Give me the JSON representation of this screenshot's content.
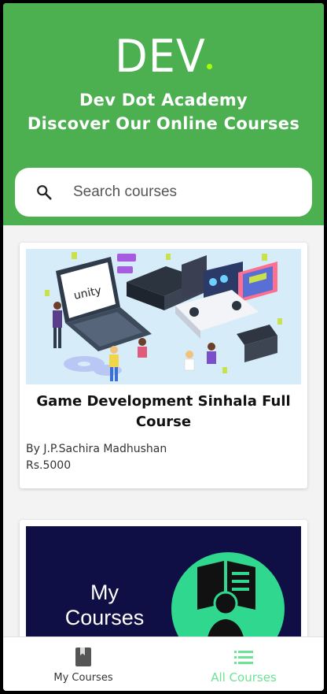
{
  "header": {
    "logo": "DEV",
    "academy_name": "Dev Dot Academy",
    "tagline": "Discover Our Online Courses",
    "background_color": "#4caf50",
    "logo_dot_color": "#a6ff00"
  },
  "search": {
    "placeholder": "Search courses",
    "icon": "search-icon"
  },
  "courses": [
    {
      "image_text": "unity",
      "title": "Game Development Sinhala Full Course",
      "author": "By J.P.Sachira Madhushan",
      "price": "Rs.5000"
    },
    {
      "image_text": "My Courses"
    }
  ],
  "bottom_nav": {
    "items": [
      {
        "label": "My Courses",
        "icon": "bookmark-icon",
        "active": false
      },
      {
        "label": "All Courses",
        "icon": "list-icon",
        "active": true
      }
    ],
    "active_color": "#6ce495"
  }
}
